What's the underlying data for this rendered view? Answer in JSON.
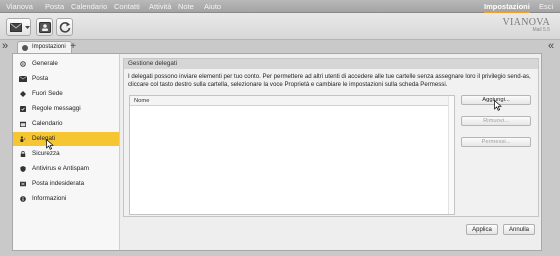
{
  "menu": {
    "items": [
      "Vianova",
      "Posta",
      "Calendario",
      "Contatti",
      "Attività",
      "Note",
      "Aiuto"
    ],
    "right": [
      "Impostazioni",
      "Esci"
    ]
  },
  "logo": {
    "brand": "VIANOVA",
    "sub": "Mail 5.5"
  },
  "tabs": {
    "active_label": "Impostazioni",
    "add_icon": "plus-icon"
  },
  "sidebar": {
    "items": [
      {
        "label": "Generale",
        "icon": "gear-icon"
      },
      {
        "label": "Posta",
        "icon": "mail-icon"
      },
      {
        "label": "Fuori Sede",
        "icon": "away-icon"
      },
      {
        "label": "Regole messaggi",
        "icon": "rules-icon"
      },
      {
        "label": "Calendario",
        "icon": "calendar-icon"
      },
      {
        "label": "Delegati",
        "icon": "delegates-icon",
        "selected": true
      },
      {
        "label": "Sicurezza",
        "icon": "lock-icon"
      },
      {
        "label": "Antivirus e Antispam",
        "icon": "shield-icon"
      },
      {
        "label": "Posta indesiderata",
        "icon": "junk-icon"
      },
      {
        "label": "Informazioni",
        "icon": "info-icon"
      }
    ]
  },
  "panel": {
    "title": "Gestione delegati",
    "description": "I delegati possono inviare elementi per tuo conto. Per permettere ad altri utenti di accedere alle tue cartelle senza assegnare loro il privilegio send-as, cliccare col tasto destro sulla cartella, selezionare la voce Proprietà e cambiare le impostazioni sulla scheda Permessi.",
    "list_header": "Nome",
    "buttons": {
      "add": "Aggiungi...",
      "remove": "Rimuovi...",
      "permissions": "Permessi..."
    }
  },
  "footer": {
    "apply": "Applica",
    "cancel": "Annulla"
  },
  "colors": {
    "selected": "#f5c632",
    "accent": "#f0a030"
  }
}
